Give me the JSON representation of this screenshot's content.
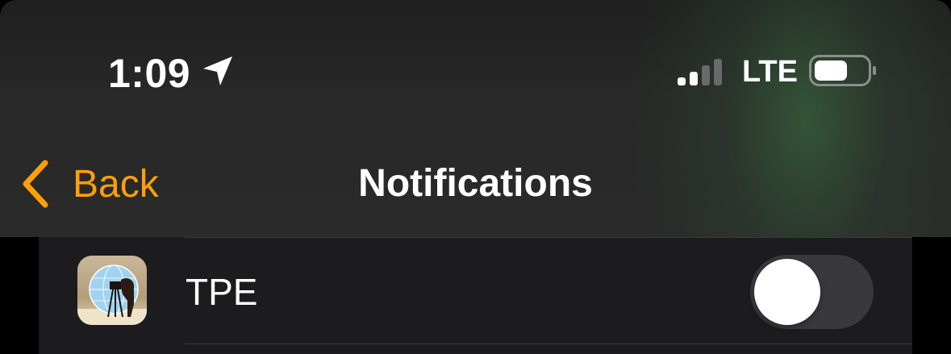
{
  "status_bar": {
    "time": "1:09",
    "network": "LTE",
    "icons": [
      "location-arrow-icon",
      "cellular-signal-icon",
      "battery-icon"
    ]
  },
  "nav": {
    "back_label": "Back",
    "title": "Notifications"
  },
  "app_row": {
    "app_name": "TPE",
    "icon": "tpe-app-icon",
    "notifications_enabled": false
  },
  "colors": {
    "accent": "#FF9F0A",
    "toggle_off": "#39393d",
    "cell_background": "#1c1c1e",
    "header_tint": "#2f4a33"
  }
}
